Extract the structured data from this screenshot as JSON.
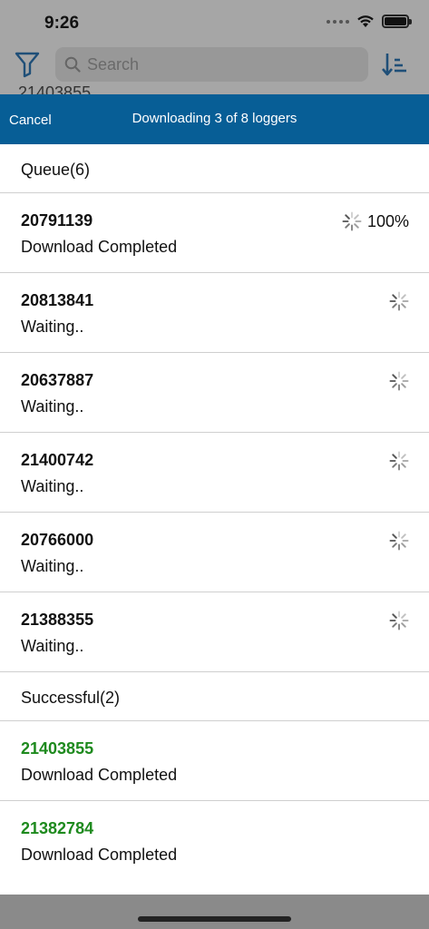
{
  "status_bar": {
    "time": "9:26"
  },
  "background": {
    "search_placeholder": "Search",
    "peek_text": "21403855"
  },
  "header": {
    "cancel_label": "Cancel",
    "title": "Downloading 3 of 8 loggers"
  },
  "queue": {
    "title": "Queue(6)",
    "items": [
      {
        "id": "20791139",
        "status": "Download Completed",
        "percent": "100%"
      },
      {
        "id": "20813841",
        "status": "Waiting..",
        "percent": ""
      },
      {
        "id": "20637887",
        "status": "Waiting..",
        "percent": ""
      },
      {
        "id": "21400742",
        "status": "Waiting..",
        "percent": ""
      },
      {
        "id": "20766000",
        "status": "Waiting..",
        "percent": ""
      },
      {
        "id": "21388355",
        "status": "Waiting..",
        "percent": ""
      }
    ]
  },
  "successful": {
    "title": "Successful(2)",
    "items": [
      {
        "id": "21403855",
        "status": "Download Completed"
      },
      {
        "id": "21382784",
        "status": "Download Completed"
      }
    ]
  },
  "colors": {
    "header_bg": "#075e96",
    "success_text": "#1e8a1e"
  },
  "icons": {
    "filter": "filter-icon",
    "search": "search-icon",
    "sort": "sort-icon",
    "spinner": "spinner-icon"
  }
}
